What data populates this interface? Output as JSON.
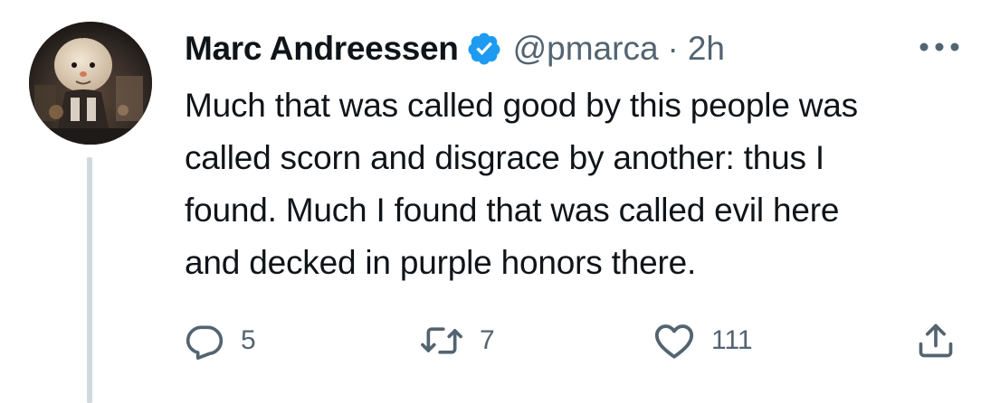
{
  "tweet": {
    "author": {
      "display_name": "Marc Andreessen",
      "handle": "@pmarca",
      "verified": true
    },
    "separator": "·",
    "time": "2h",
    "text_lines": [
      "Much that was called good by this people was",
      "called scorn and disgrace by another: thus I",
      "found. Much I found that was called evil here",
      "and decked in purple honors there."
    ],
    "actions": {
      "reply": {
        "icon": "reply-icon",
        "count": "5"
      },
      "retweet": {
        "icon": "retweet-icon",
        "count": "7"
      },
      "like": {
        "icon": "heart-icon",
        "count": "111"
      },
      "share": {
        "icon": "share-icon"
      }
    }
  },
  "colors": {
    "text_primary": "#0f1419",
    "text_secondary": "#536471",
    "verified_blue": "#1d9bf0",
    "thread_line": "#cfd9de"
  }
}
